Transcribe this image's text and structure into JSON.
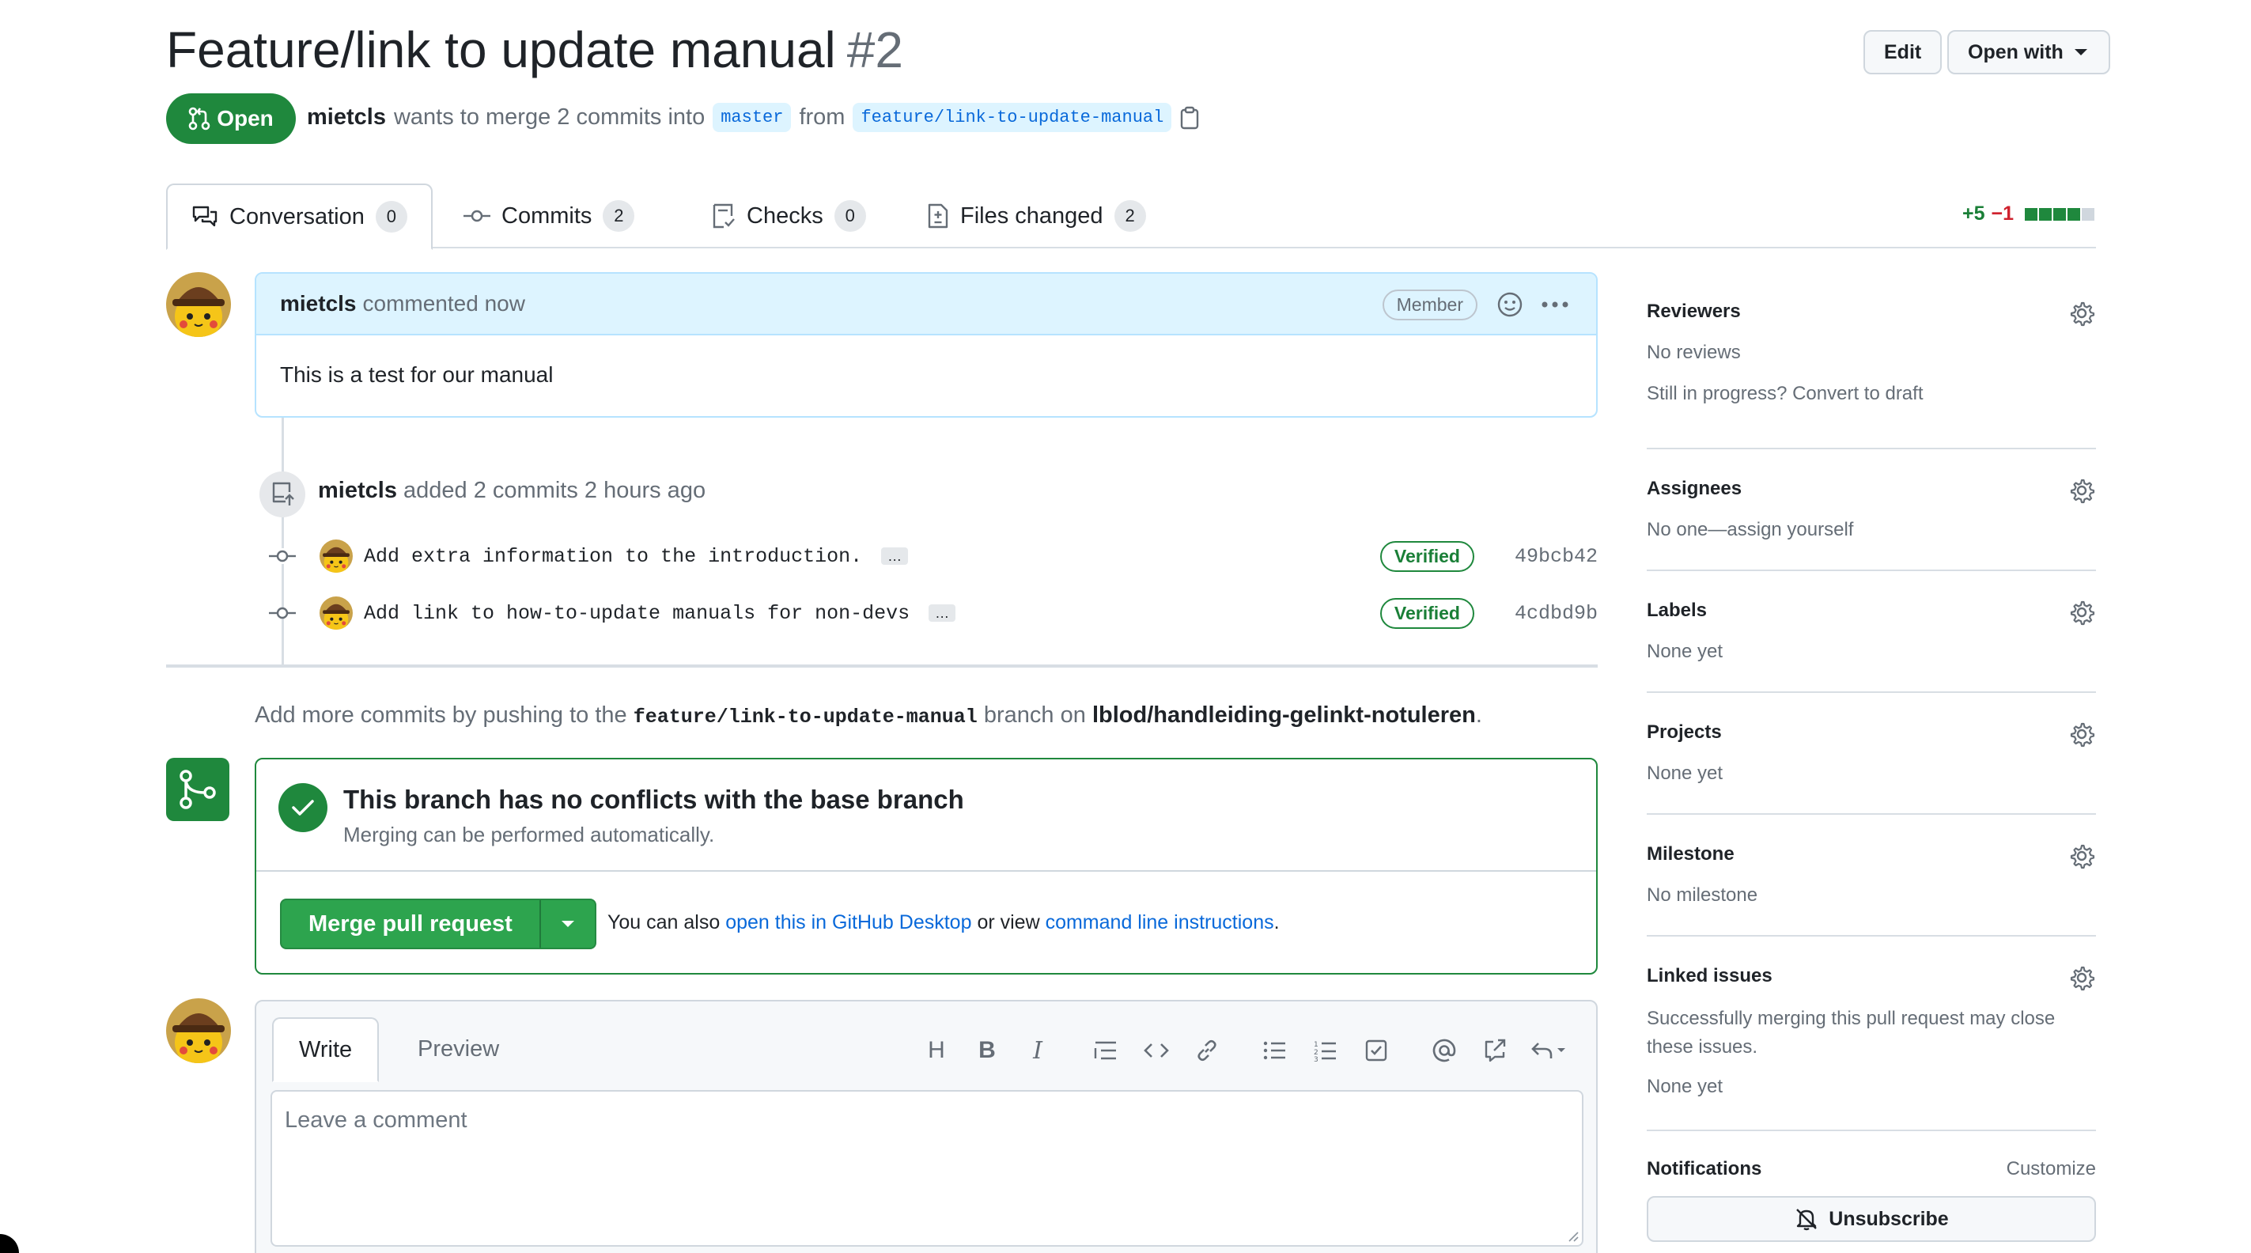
{
  "header": {
    "title": "Feature/link to update manual",
    "number": "#2",
    "edit_label": "Edit",
    "open_with_label": "Open with"
  },
  "state": {
    "label": "Open",
    "author": "mietcls",
    "merge_text": "wants to merge 2 commits into",
    "base_branch": "master",
    "from_text": "from",
    "head_branch": "feature/link-to-update-manual"
  },
  "tabs": [
    {
      "label": "Conversation",
      "count": "0"
    },
    {
      "label": "Commits",
      "count": "2"
    },
    {
      "label": "Checks",
      "count": "0"
    },
    {
      "label": "Files changed",
      "count": "2"
    }
  ],
  "diffstat": {
    "additions": "+5",
    "deletions": "−1",
    "colors": [
      "#1f883d",
      "#1f883d",
      "#1f883d",
      "#1f883d",
      "#d0d7de"
    ]
  },
  "comment": {
    "author": "mietcls",
    "action": "commented now",
    "badge": "Member",
    "body": "This is a test for our manual"
  },
  "commits_event": {
    "author": "mietcls",
    "text": "added 2 commits 2 hours ago"
  },
  "commits": [
    {
      "message": "Add extra information to the introduction.",
      "verified": "Verified",
      "sha": "49bcb42"
    },
    {
      "message": "Add link to how-to-update manuals for non-devs",
      "verified": "Verified",
      "sha": "4cdbd9b"
    }
  ],
  "push_note": {
    "prefix": "Add more commits by pushing to the",
    "branch": "feature/link-to-update-manual",
    "middle": "branch on",
    "repo": "lblod/handleiding-gelinkt-notuleren",
    "suffix": "."
  },
  "merge": {
    "title": "This branch has no conflicts with the base branch",
    "subtitle": "Merging can be performed automatically.",
    "button": "Merge pull request",
    "alt_prefix": "You can also",
    "alt_link1": "open this in GitHub Desktop",
    "alt_middle": "or view",
    "alt_link2": "command line instructions",
    "alt_suffix": "."
  },
  "editor": {
    "write_tab": "Write",
    "preview_tab": "Preview",
    "placeholder": "Leave a comment"
  },
  "sidebar": {
    "reviewers": {
      "heading": "Reviewers",
      "value": "No reviews",
      "note": "Still in progress? Convert to draft"
    },
    "assignees": {
      "heading": "Assignees",
      "value": "No one—assign yourself"
    },
    "labels": {
      "heading": "Labels",
      "value": "None yet"
    },
    "projects": {
      "heading": "Projects",
      "value": "None yet"
    },
    "milestone": {
      "heading": "Milestone",
      "value": "No milestone"
    },
    "linked_issues": {
      "heading": "Linked issues",
      "description": "Successfully merging this pull request may close these issues.",
      "value": "None yet"
    },
    "notifications": {
      "heading": "Notifications",
      "customize": "Customize",
      "unsubscribe": "Unsubscribe"
    }
  },
  "colors": {
    "accent": "#0969da",
    "success": "#1f883d",
    "merge_button": "#2da44e"
  }
}
